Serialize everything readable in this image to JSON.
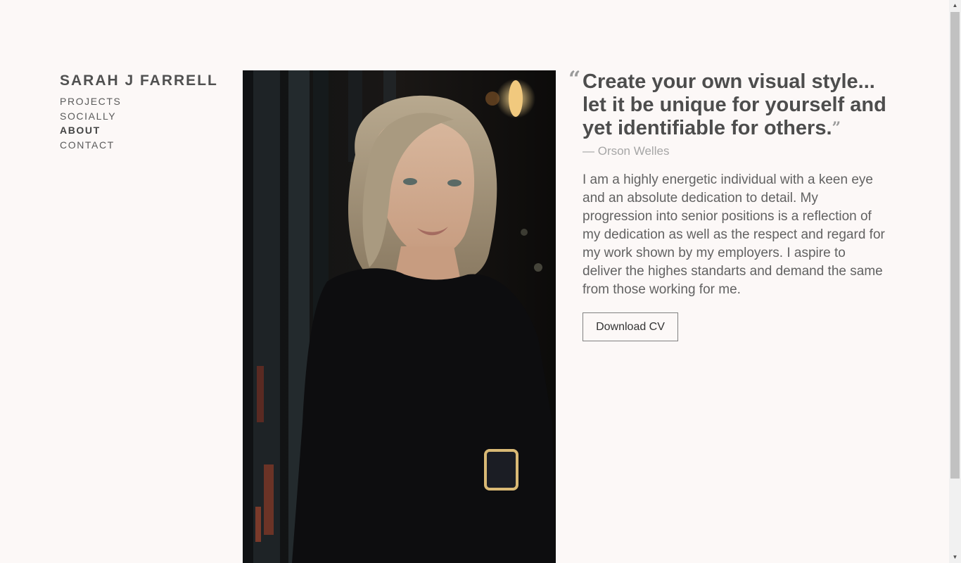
{
  "site": {
    "name": "SARAH J FARRELL"
  },
  "nav": {
    "items": [
      {
        "label": "PROJECTS",
        "active": false
      },
      {
        "label": "SOCIALLY",
        "active": false
      },
      {
        "label": "ABOUT",
        "active": true
      },
      {
        "label": "CONTACT",
        "active": false
      }
    ]
  },
  "photo": {
    "icon": "portrait-photo"
  },
  "quote": {
    "open_mark": "“",
    "text": "Create your own visual style... let it be unique for yourself and yet identifiable for others.",
    "close_mark": "”",
    "author": "— Orson Welles"
  },
  "bio": {
    "text": "I am a highly energetic individual with a keen eye and an absolute dedication to detail. My progression into senior positions is a reflection of my dedication as well as the respect and regard for my work shown by my employers. I aspire to deliver the highes standarts and demand the same from those working for me."
  },
  "cv": {
    "button_label": "Download CV"
  },
  "scrollbar": {
    "up_icon": "▲",
    "down_icon": "▼"
  },
  "colors": {
    "background": "#fcf8f7",
    "text": "#4a4a4a",
    "muted": "#a6a6a6"
  }
}
